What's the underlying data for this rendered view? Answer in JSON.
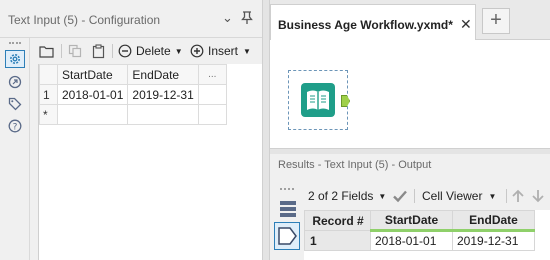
{
  "config_panel": {
    "title": "Text Input (5) - Configuration",
    "toolbar": {
      "delete_label": "Delete",
      "insert_label": "Insert"
    },
    "table": {
      "columns": [
        "StartDate",
        "EndDate"
      ],
      "more_columns": "...",
      "rows": [
        {
          "num": "1",
          "cells": [
            "2018-01-01",
            "2019-12-31"
          ]
        }
      ],
      "new_row_marker": "*"
    }
  },
  "workflow": {
    "tab_title": "Business Age Workflow.yxmd*",
    "tool_icon": "book-icon"
  },
  "results": {
    "title": "Results - Text Input (5) - Output",
    "fields_selector": "2 of 2 Fields",
    "viewer_selector": "Cell Viewer",
    "table": {
      "record_header": "Record #",
      "columns": [
        "StartDate",
        "EndDate"
      ],
      "rows": [
        {
          "num": "1",
          "cells": [
            "2018-01-01",
            "2019-12-31"
          ]
        }
      ]
    }
  },
  "colors": {
    "accent_blue": "#2d7fb8",
    "tool_green": "#1f9e89",
    "field_bar_green": "#8fd06a"
  }
}
